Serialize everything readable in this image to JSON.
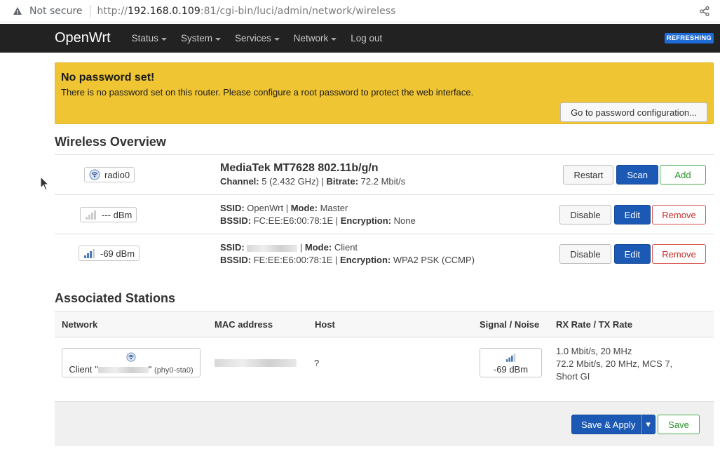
{
  "browser": {
    "security_label": "Not secure",
    "url_prefix": "http://",
    "url_host": "192.168.0.109",
    "url_rest": ":81/cgi-bin/luci/admin/network/wireless"
  },
  "nav": {
    "brand": "OpenWrt",
    "menu": [
      "Status",
      "System",
      "Services",
      "Network",
      "Log out"
    ],
    "refresh_badge": "REFRESHING"
  },
  "alert": {
    "title": "No password set!",
    "text": "There is no password set on this router. Please configure a root password to protect the web interface.",
    "button": "Go to password configuration..."
  },
  "wireless": {
    "title": "Wireless Overview",
    "device": {
      "badge": "radio0",
      "name": "MediaTek MT7628 802.11b/g/n",
      "channel_label": "Channel:",
      "channel_value": "5 (2.432 GHz)",
      "bitrate_label": "Bitrate:",
      "bitrate_value": "72.2 Mbit/s",
      "buttons": [
        "Restart",
        "Scan",
        "Add"
      ]
    },
    "networks": [
      {
        "badge": "--- dBm",
        "ssid_label": "SSID:",
        "ssid": "OpenWrt",
        "mode_label": "Mode:",
        "mode": "Master",
        "bssid_label": "BSSID:",
        "bssid": "FC:EE:E6:00:78:1E",
        "enc_label": "Encryption:",
        "enc": "None",
        "buttons": [
          "Disable",
          "Edit",
          "Remove"
        ]
      },
      {
        "badge": "-69 dBm",
        "ssid_label": "SSID:",
        "ssid": "",
        "mode_label": "Mode:",
        "mode": "Client",
        "bssid_label": "BSSID:",
        "bssid": "FE:EE:E6:00:78:1E",
        "enc_label": "Encryption:",
        "enc": "WPA2 PSK (CCMP)",
        "buttons": [
          "Disable",
          "Edit",
          "Remove"
        ]
      }
    ]
  },
  "stations": {
    "title": "Associated Stations",
    "headers": [
      "Network",
      "MAC address",
      "Host",
      "Signal / Noise",
      "RX Rate / TX Rate"
    ],
    "row": {
      "network_prefix": "Client \"",
      "network_suffix": "\"",
      "network_iface": "(phy0-sta0)",
      "host": "?",
      "signal": "-69 dBm",
      "rates": [
        "1.0 Mbit/s, 20 MHz",
        "72.2 Mbit/s, 20 MHz, MCS 7,",
        "Short GI"
      ]
    }
  },
  "footer": {
    "save_apply": "Save & Apply",
    "dropdown": "▾",
    "save": "Save"
  },
  "colors": {
    "navbar": "#222222",
    "alert": "#f0c534",
    "primary": "#1b59b5",
    "positive": "#4cae4c",
    "negative": "#d9534f"
  }
}
